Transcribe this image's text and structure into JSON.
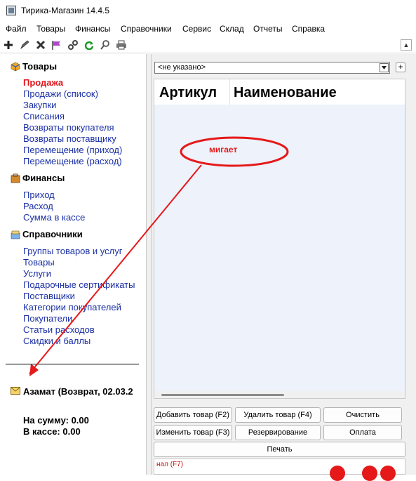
{
  "window": {
    "title": "Тирика-Магазин 14.4.5"
  },
  "menu": [
    "Файл",
    "Товары",
    "Финансы",
    "Справочники",
    "Сервис",
    "Склад",
    "Отчеты",
    "Справка"
  ],
  "sidebar": {
    "goods_title": "Товары",
    "goods_items": [
      "Продажа",
      "Продажи (список)",
      "Закупки",
      "Списания",
      "Возвраты покупателя",
      "Возвраты поставщику",
      "Перемещение (приход)",
      "Перемещение (расход)"
    ],
    "finance_title": "Финансы",
    "finance_items": [
      "Приход",
      "Расход",
      "Сумма в кассе"
    ],
    "refs_title": "Справочники",
    "refs_items": [
      "Группы товаров и услуг",
      "Товары",
      "Услуги",
      "Подарочные сертификаты",
      "Поставщики",
      "Категории покупателей",
      "Покупатели",
      "Статьи расходов",
      "Скидки и баллы"
    ],
    "notification": "Азамат (Возврат, 02.03.2",
    "sum_label": "На сумму: 0.00",
    "cash_label": "В кассе: 0.00"
  },
  "main": {
    "customer_select": "<не указано>",
    "plus_label": "+",
    "columns": [
      "Артикул",
      "Наименование"
    ],
    "buttons": {
      "add": "Добавить товар (F2)",
      "remove": "Удалить товар (F4)",
      "clear": "Очистить",
      "edit": "Изменить товар (F3)",
      "reserve": "Резервирование",
      "pay": "Оплата",
      "print": "Печать"
    },
    "cash_label": "нал (F7)"
  },
  "annotation": {
    "text": "мигает",
    "color": "#e51919"
  },
  "colors": {
    "link": "#1a2fa5",
    "active": "#e2161a",
    "grid_bg": "#edf2fb"
  }
}
